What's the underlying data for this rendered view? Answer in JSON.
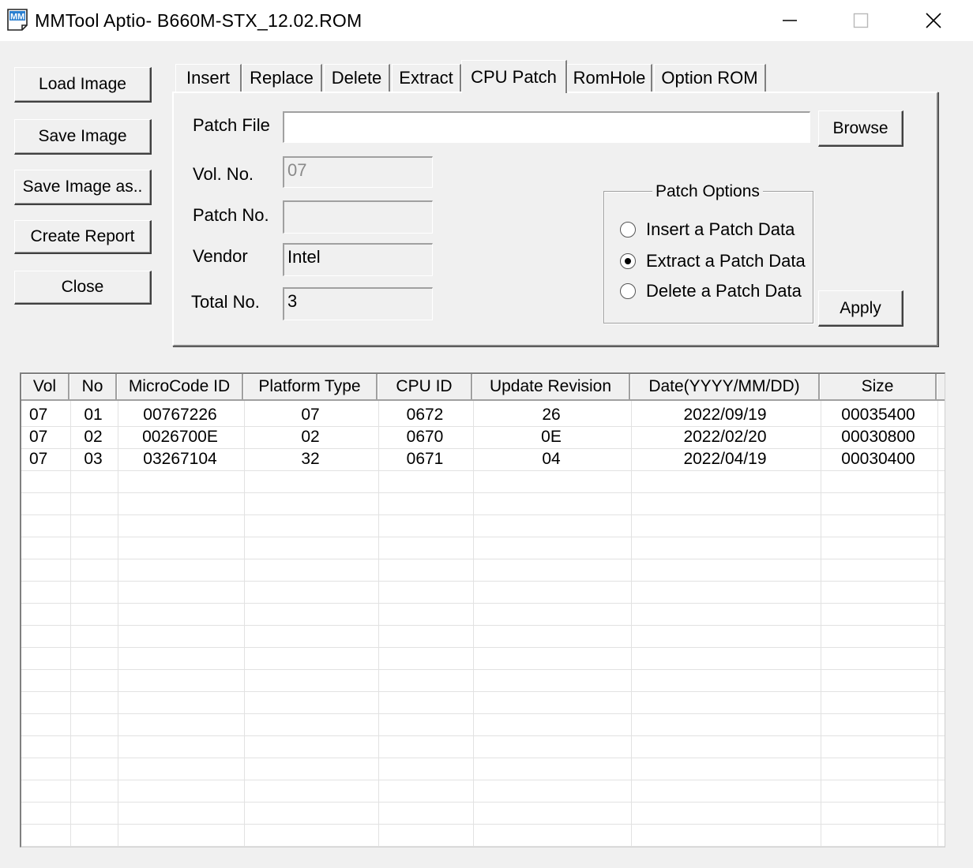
{
  "window": {
    "title": "MMTool Aptio- B660M-STX_12.02.ROM",
    "app_icon": "mm-app-icon",
    "controls": {
      "minimize": "minimize-icon",
      "maximize": "maximize-icon",
      "close": "close-icon"
    }
  },
  "side_buttons": {
    "load": "Load Image",
    "save": "Save Image",
    "save_as": "Save Image as..",
    "report": "Create Report",
    "close": "Close"
  },
  "tabs": [
    {
      "label": "Insert"
    },
    {
      "label": "Replace"
    },
    {
      "label": "Delete"
    },
    {
      "label": "Extract"
    },
    {
      "label": "CPU Patch",
      "active": true
    },
    {
      "label": "RomHole"
    },
    {
      "label": "Option ROM"
    }
  ],
  "patch_panel": {
    "patch_file_label": "Patch File",
    "patch_file_value": "",
    "browse": "Browse",
    "vol_label": "Vol. No.",
    "vol_value": "07",
    "patch_no_label": "Patch No.",
    "patch_no_value": "",
    "vendor_label": "Vendor",
    "vendor_value": "Intel",
    "total_label": "Total No.",
    "total_value": "3",
    "options_title": "Patch Options",
    "options": [
      {
        "label": "Insert a Patch Data",
        "checked": false
      },
      {
        "label": "Extract a Patch Data",
        "checked": true
      },
      {
        "label": "Delete a Patch Data",
        "checked": false
      }
    ],
    "apply": "Apply"
  },
  "table": {
    "columns": [
      "Vol",
      "No",
      "MicroCode ID",
      "Platform Type",
      "CPU ID",
      "Update Revision",
      "Date(YYYY/MM/DD)",
      "Size"
    ],
    "rows": [
      [
        "07",
        "01",
        "00767226",
        "07",
        "0672",
        "26",
        "2022/09/19",
        "00035400"
      ],
      [
        "07",
        "02",
        "0026700E",
        "02",
        "0670",
        "0E",
        "2022/02/20",
        "00030800"
      ],
      [
        "07",
        "03",
        "03267104",
        "32",
        "0671",
        "04",
        "2022/04/19",
        "00030400"
      ]
    ]
  }
}
